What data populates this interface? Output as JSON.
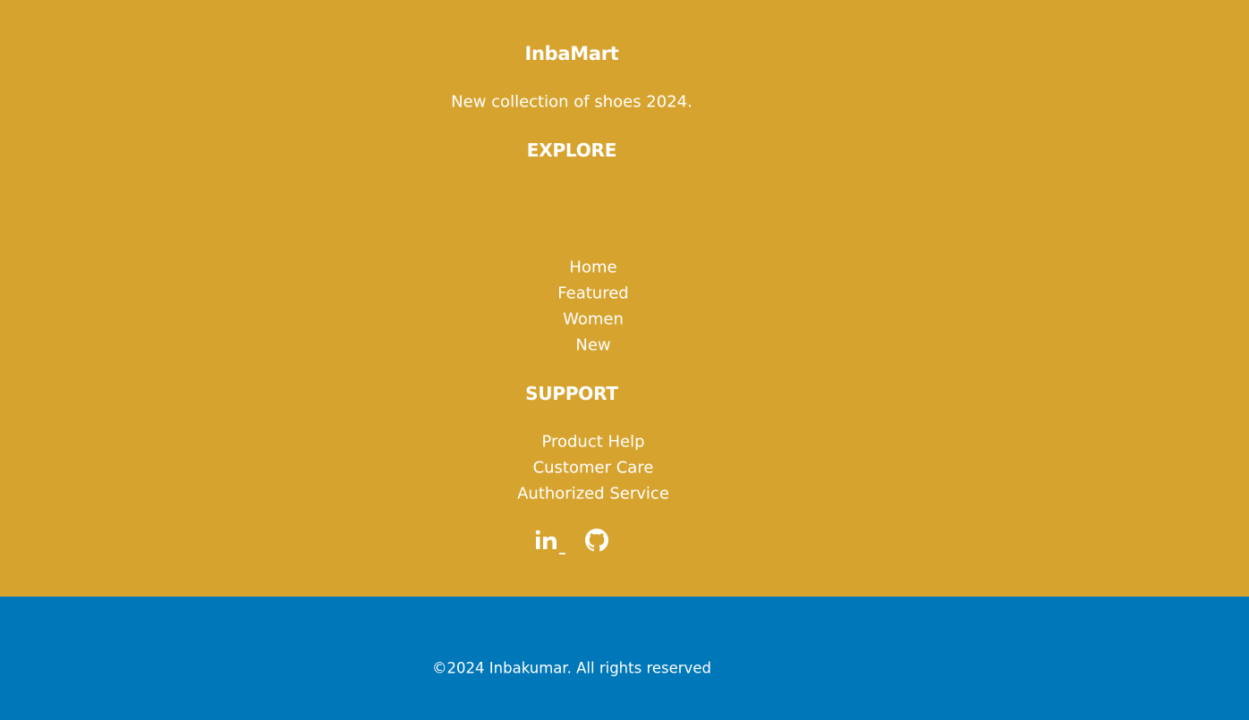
{
  "brand": {
    "name": "InbaMart",
    "tagline": "New collection of shoes 2024."
  },
  "explore": {
    "heading": "EXPLORE",
    "links": [
      "Home",
      "Featured",
      "Women",
      "New"
    ]
  },
  "support": {
    "heading": "SUPPORT",
    "links": [
      "Product Help",
      "Customer Care",
      "Authorized Service"
    ]
  },
  "social": {
    "icons": [
      "linkedin-icon",
      "github-icon"
    ]
  },
  "copyright": "©2024 Inbakumar. All rights reserved",
  "colors": {
    "footer_background": "#d6a32e",
    "bottom_bar_background": "#0077b8",
    "text": "#ffffff"
  }
}
